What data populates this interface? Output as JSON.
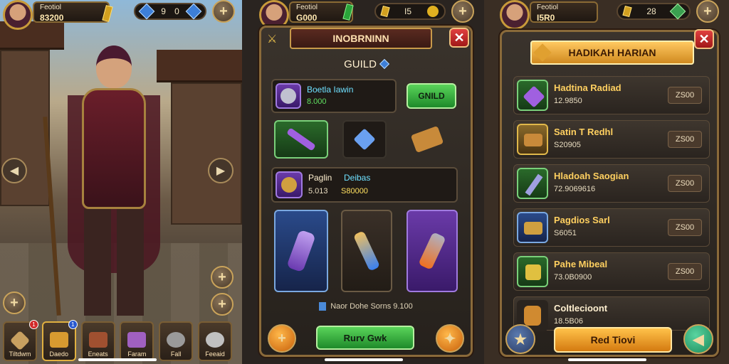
{
  "left": {
    "player": {
      "name": "Feotiol",
      "gold": "83200"
    },
    "gems": {
      "value": "9",
      "count": "0"
    },
    "nav": [
      {
        "label": "Tiltdwm",
        "badge": "1"
      },
      {
        "label": "Daedo",
        "badge": "1"
      },
      {
        "label": "Eneats",
        "badge": ""
      },
      {
        "label": "Faram",
        "badge": ""
      },
      {
        "label": "Fall",
        "badge": ""
      },
      {
        "label": "Feeaid",
        "badge": ""
      }
    ]
  },
  "mid": {
    "player": {
      "name": "Feotiol",
      "gold": "G000"
    },
    "currency": {
      "value": "I5"
    },
    "panel_title": "INOBRNINN",
    "section_label": "GUILD",
    "guild_card": {
      "name": "Boetla Iawin",
      "sub": "8.000"
    },
    "guild_button": "GNILD",
    "member_card": {
      "name": "Paglin",
      "name_accent": "Deibas",
      "sub_a": "5.013",
      "sub_b": "S80000"
    },
    "info_line": "Naor Dohe Sorns 9.100",
    "primary_button": "Rurv Gwk",
    "colors": {
      "accent_green": "#3fbf3f",
      "accent_gold": "#f0a020",
      "close_red": "#d83030"
    }
  },
  "right": {
    "player": {
      "name": "Feotiol",
      "gold": "I5R0"
    },
    "currency": {
      "value": "28"
    },
    "banner_title": "HADIKAH HARIAN",
    "rows": [
      {
        "name": "Hadtina Radiad",
        "sub": "12.9850",
        "price": "ZS00",
        "thumb": "purple"
      },
      {
        "name": "Satin T Redhl",
        "sub": "S20905",
        "price": "ZS00",
        "thumb": "gold"
      },
      {
        "name": "Hladoah Saogian",
        "sub": "72.9069616",
        "price": "ZS00",
        "thumb": "green"
      },
      {
        "name": "Pagdios Sarl",
        "sub": "S6051",
        "price": "ZS00",
        "thumb": "blue"
      },
      {
        "name": "Pahe Mibeal",
        "sub": "73.0B0900",
        "price": "ZS00",
        "thumb": "green"
      },
      {
        "name": "Coltlecioont",
        "sub": "18.5B06",
        "price": "",
        "thumb": "dark"
      }
    ],
    "primary_button": "Red Tiovi"
  }
}
